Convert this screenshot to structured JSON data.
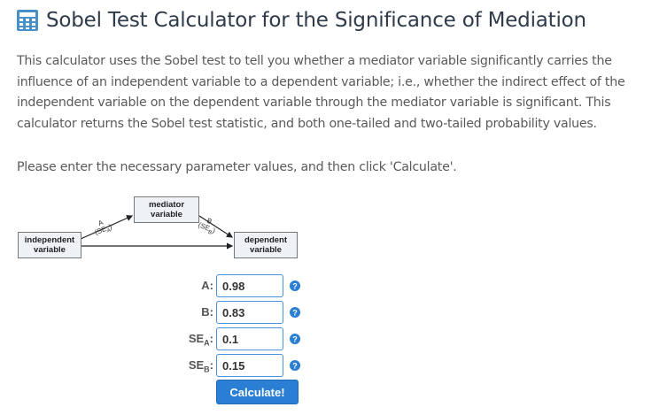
{
  "header": {
    "title": "Sobel Test Calculator for the Significance of Mediation",
    "icon": "calculator-icon",
    "icon_color": "#4a90c8"
  },
  "intro": "This calculator uses the Sobel test to tell you whether a mediator variable significantly carries the influence of an independent variable to a dependent variable; i.e., whether the indirect effect of the independent variable on the dependent variable through the mediator variable is significant. This calculator returns the Sobel test statistic, and both one-tailed and two-tailed probability values.",
  "instructions": "Please enter the necessary parameter values, and then click 'Calculate'.",
  "diagram": {
    "mediator": [
      "mediator",
      "variable"
    ],
    "independent": [
      "independent",
      "variable"
    ],
    "dependent": [
      "dependent",
      "variable"
    ],
    "path_a": {
      "letter": "A",
      "se": "(SE",
      "se_sub": "A",
      "close": ")"
    },
    "path_b": {
      "letter": "B",
      "se": "(SE",
      "se_sub": "B",
      "close": ")"
    }
  },
  "form": {
    "a": {
      "label": "A:",
      "value": "0.98"
    },
    "b": {
      "label": "B:",
      "value": "0.83"
    },
    "sea": {
      "label_main": "SE",
      "label_sub": "A",
      "label_colon": ":",
      "value": "0.1"
    },
    "seb": {
      "label_main": "SE",
      "label_sub": "B",
      "label_colon": ":",
      "value": "0.15"
    },
    "help_icon": "question-circle-icon",
    "accent": "#2a7fd4"
  },
  "calculate_label": "Calculate!"
}
